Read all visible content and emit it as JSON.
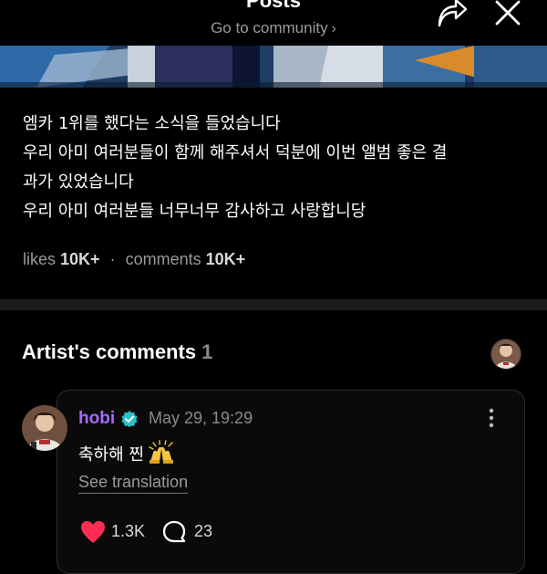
{
  "header": {
    "title": "Posts",
    "community_link": "Go to community",
    "community_chevron": "›",
    "share_icon": "share-icon",
    "close_icon": "close-icon"
  },
  "post": {
    "lines": [
      "엠카 1위를 했다는 소식을 들었습니다",
      "우리 아미 여러분들이 함께 해주셔서 덕분에 이번 앨범 좋은 결",
      "과가 있었습니다",
      "우리 아미 여러분들 너무너무 감사하고 사랑합니당"
    ],
    "likes_label": "likes",
    "likes_value": "10K+",
    "separator": "·",
    "comments_label": "comments",
    "comments_value": "10K+"
  },
  "artist_comments": {
    "title": "Artist's comments",
    "count": "1"
  },
  "comment": {
    "author": "hobi",
    "date": "May 29, 19:29",
    "text": "축하해 찐",
    "emoji": "raising-hands-icon",
    "see_translation": "See translation",
    "likes": "1.3K",
    "replies": "23"
  },
  "colors": {
    "accent_purple": "#a56cff",
    "verified_teal": "#2bc0c8",
    "heart_red": "#ff2d55",
    "muted_gray": "#9a9a9a"
  }
}
